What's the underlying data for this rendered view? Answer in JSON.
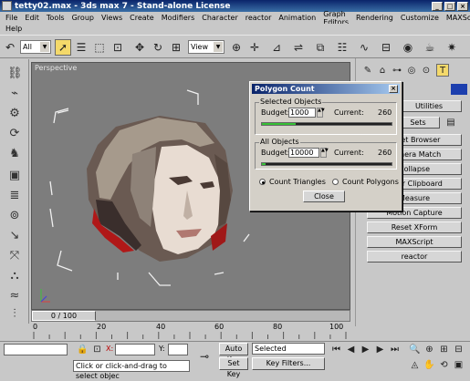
{
  "window": {
    "title": "tetty02.max - 3ds max 7 - Stand-alone License"
  },
  "menu": {
    "items": [
      "File",
      "Edit",
      "Tools",
      "Group",
      "Views",
      "Create",
      "Modifiers",
      "Character",
      "reactor",
      "Animation",
      "Graph Editors",
      "Rendering",
      "Customize",
      "MAXScript"
    ],
    "second_row": "Help"
  },
  "toolbar": {
    "selection_filter": "All",
    "ref_coord": "View"
  },
  "viewport": {
    "label": "Perspective"
  },
  "command_panel": {
    "buttons": [
      "Utilities",
      "Sets",
      "Asset Browser",
      "Camera Match",
      "Collapse",
      "Color Clipboard",
      "Measure",
      "Motion Capture",
      "Reset XForm",
      "MAXScript",
      "reactor"
    ]
  },
  "dialog": {
    "title": "Polygon Count",
    "selected": {
      "group": "Selected Objects",
      "budget_label": "Budget:",
      "budget_value": "1000",
      "current_label": "Current:",
      "current_value": "260",
      "fill": 0.26
    },
    "all": {
      "group": "All Objects",
      "budget_label": "Budget:",
      "budget_value": "10000",
      "current_label": "Current:",
      "current_value": "260",
      "fill": 0.026
    },
    "count_triangles": "Count Triangles",
    "count_polygons": "Count Polygons",
    "close": "Close"
  },
  "timeline": {
    "frame": "0 / 100",
    "ticks": [
      "0",
      "20",
      "40",
      "60",
      "80",
      "100"
    ]
  },
  "status": {
    "x_label": "X:",
    "y_label": "Y:",
    "prompt": "Click or click-and-drag to select objec",
    "auto_key": "Auto Key",
    "set_key": "Set Key",
    "selected": "Selected",
    "key_filters": "Key Filters..."
  }
}
